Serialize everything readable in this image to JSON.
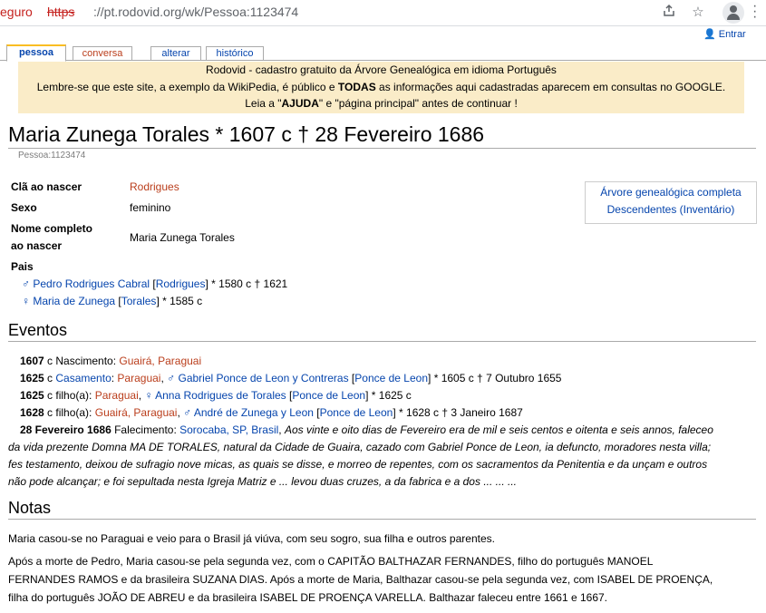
{
  "browser": {
    "security_text": "eguro",
    "url_scheme": "https",
    "url_rest": "://pt.rodovid.org/wk/Pessoa:1123474",
    "share_icon": "share-icon",
    "star_icon": "star-icon",
    "menu_icon": "kebab-menu-icon"
  },
  "login": {
    "label": "Entrar"
  },
  "tabs": [
    {
      "label": "pessoa"
    },
    {
      "label": "conversa"
    },
    {
      "label": "alterar"
    },
    {
      "label": "histórico"
    }
  ],
  "notice": {
    "line1": "Rodovid - cadastro gratuito da Árvore Genealógica em idioma Português",
    "line2_a": "Lembre-se que este site, a exemplo da WikiPedia, é público e ",
    "line2_b": "TODAS",
    "line2_c": " as informações aqui cadastradas aparecem em consultas no GOOGLE.",
    "line3_a": "Leia a \"",
    "line3_b": "AJUDA",
    "line3_c": "\" e \"página principal\" antes de continuar !"
  },
  "title": "Maria Zunega Torales * 1607 c † 28 Fevereiro 1686",
  "person_id": "Pessoa:1123474",
  "info": {
    "clan_label": "Clã ao nascer",
    "clan_value": "Rodrigues",
    "sex_label": "Sexo",
    "sex_value": "feminino",
    "fullname_label_1": "Nome completo",
    "fullname_label_2": "ao nascer",
    "fullname_value": "Maria Zunega Torales",
    "parents_label": "Pais",
    "father_sym": "♂",
    "father_name": "Pedro Rodrigues Cabral",
    "father_clan": "Rodrigues",
    "father_dates": " * 1580 c † 1621",
    "mother_sym": "♀",
    "mother_name": "Maria de Zunega",
    "mother_clan": "Torales",
    "mother_dates": " * 1585 c"
  },
  "sidebox": {
    "tree_link": "Árvore genealógica completa",
    "desc_link": "Descendentes (Inventário)"
  },
  "events_heading": "Eventos",
  "events": {
    "e1_date": "1607",
    "e1_c": " c ",
    "e1_type": "Nascimento: ",
    "e1_place": "Guairá, Paraguai",
    "e2_date": "1625",
    "e2_c": " c ",
    "e2_type": "Casamento",
    "e2_colon": ": ",
    "e2_place": "Paraguai",
    "e2_sep": ", ",
    "e2_sym": "♂",
    "e2_person": "Gabriel Ponce de Leon y Contreras",
    "e2_clan": "Ponce de Leon",
    "e2_dates": " * 1605 c † 7 Outubro 1655",
    "e3_date": "1625",
    "e3_c": " c ",
    "e3_type": "filho(a): ",
    "e3_place": "Paraguai",
    "e3_sep": ", ",
    "e3_sym": "♀",
    "e3_person": "Anna Rodrigues de Torales",
    "e3_clan": "Ponce de Leon",
    "e3_dates": " * 1625 c",
    "e4_date": "1628",
    "e4_c": " c ",
    "e4_type": "filho(a): ",
    "e4_place": "Guairá, Paraguai",
    "e4_sep": ", ",
    "e4_sym": "♂",
    "e4_person": "André de Zunega y Leon",
    "e4_clan": "Ponce de Leon",
    "e4_dates": " * 1628 c † 3 Janeiro 1687",
    "e5_date": "28 Fevereiro 1686",
    "e5_type": " Falecimento: ",
    "e5_place": "Sorocaba, SP, Brasil",
    "e5_sep": ", ",
    "e5_note_1": "Aos vinte e oito dias de Fevereiro era de mil e seis centos e oitenta e seis annos, faleceo",
    "e5_note_2": "da vida prezente Domna MA DE TORALES, natural da Cidade de Guaira, cazado com Gabriel Ponce de Leon, ia defuncto, moradores nesta villa;",
    "e5_note_3": "fes testamento, deixou de sufragio nove micas, as quais se disse, e morreo de repentes, com os sacramentos da Penitentia e da unçam e outros",
    "e5_note_4": "não pode alcançar; e foi sepultada nesta Igreja Matriz e ... levou duas cruzes, a da fabrica e a dos ... ... ..."
  },
  "notes_heading": "Notas",
  "notes": {
    "p1": "Maria casou-se no Paraguai e veio para o Brasil já viúva, com seu sogro, sua filha e outros parentes.",
    "p2_1": "Após a morte de Pedro, Maria casou-se pela segunda vez, com o CAPITÃO BALTHAZAR FERNANDES, filho do português MANOEL",
    "p2_2": "FERNANDES RAMOS e da brasileira SUZANA DIAS. Após a morte de Maria, Balthazar casou-se pela segunda vez, com ISABEL DE PROENÇA,",
    "p2_3": "filha do português JOÃO DE ABREU e da brasileira ISABEL DE PROENÇA VARELLA. Balthazar faleceu entre 1661 e 1667."
  },
  "colors": {
    "red_link": "#ba3e1c",
    "blue_link": "#0645ad",
    "notice_bg": "#faecc8",
    "tab_accent": "#fabd23"
  }
}
